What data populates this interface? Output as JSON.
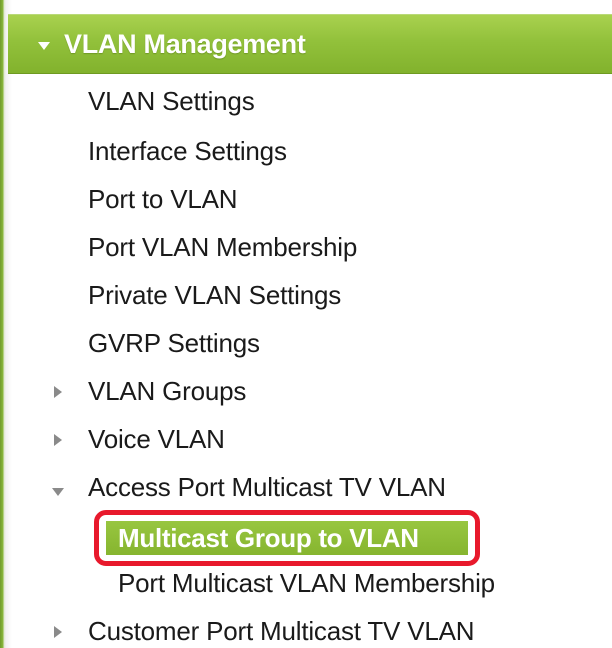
{
  "section": {
    "title": "VLAN Management",
    "expanded": true
  },
  "items": [
    {
      "label": "VLAN Settings"
    },
    {
      "label": "Interface Settings"
    },
    {
      "label": "Port to VLAN"
    },
    {
      "label": "Port VLAN Membership"
    },
    {
      "label": "Private VLAN Settings"
    },
    {
      "label": "GVRP Settings"
    },
    {
      "label": "VLAN Groups",
      "expandable": true,
      "expanded": false
    },
    {
      "label": "Voice VLAN",
      "expandable": true,
      "expanded": false
    },
    {
      "label": "Access Port Multicast TV VLAN",
      "expandable": true,
      "expanded": true
    },
    {
      "label": "Multicast Group to VLAN",
      "selected": true,
      "highlighted": true
    },
    {
      "label": "Port Multicast VLAN Membership"
    },
    {
      "label": "Customer Port Multicast TV VLAN",
      "expandable": true,
      "expanded": false
    }
  ],
  "colors": {
    "accent_green": "#8ab83d",
    "highlight_red": "#e8192c",
    "text": "#1a1a1a",
    "header_text": "#ffffff"
  },
  "icons": {
    "expanded": "triangle-down-icon",
    "collapsed": "triangle-right-icon"
  }
}
